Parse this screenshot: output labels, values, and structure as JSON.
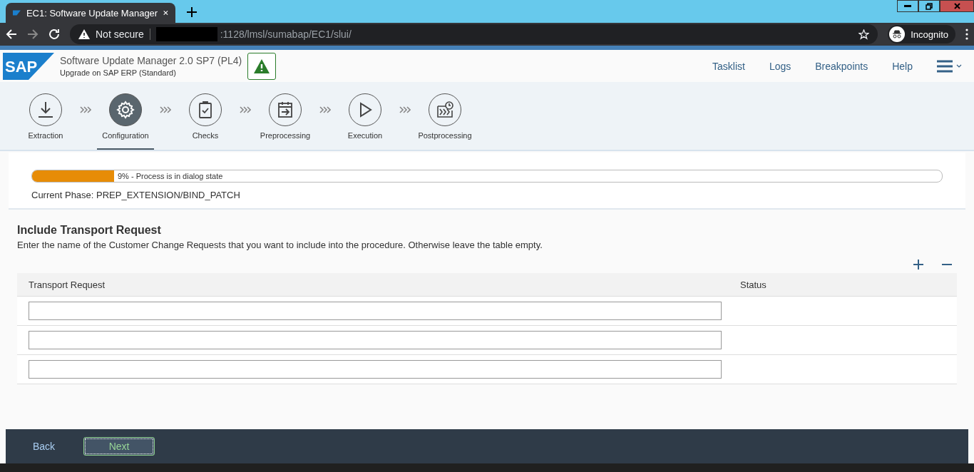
{
  "browser": {
    "tab_title": "EC1: Software Update Manager",
    "security": "Not secure",
    "url": ":1128/lmsl/sumabap/EC1/slui/",
    "profile": "Incognito"
  },
  "header": {
    "logo": "SAP",
    "title": "Software Update Manager 2.0 SP7 (PL4)",
    "subtitle": "Upgrade on SAP ERP (Standard)",
    "nav": [
      "Tasklist",
      "Logs",
      "Breakpoints",
      "Help"
    ]
  },
  "steps": [
    {
      "label": "Extraction",
      "kind": "download",
      "selected": false
    },
    {
      "label": "Configuration",
      "kind": "gear",
      "selected": true
    },
    {
      "label": "Checks",
      "kind": "clipboard",
      "selected": false
    },
    {
      "label": "Preprocessing",
      "kind": "calendar",
      "selected": false
    },
    {
      "label": "Execution",
      "kind": "play",
      "selected": false
    },
    {
      "label": "Postprocessing",
      "kind": "clock",
      "selected": false
    }
  ],
  "progress": {
    "level": 0.09,
    "text": "9% - Process is in dialog state",
    "phase": "Current Phase: PREP_EXTENSION/BIND_PATCH"
  },
  "section": {
    "title": "Include Transport Request",
    "description": "Enter the name of the Customer Change Requests that you want to include into the procedure. Otherwise leave the table empty."
  },
  "table": {
    "columns": [
      "Transport Request",
      "Status"
    ],
    "rows": [
      {
        "value": "",
        "status": ""
      },
      {
        "value": "",
        "status": ""
      },
      {
        "value": "",
        "status": ""
      }
    ]
  },
  "footer": {
    "back": "Back",
    "next": "Next"
  }
}
